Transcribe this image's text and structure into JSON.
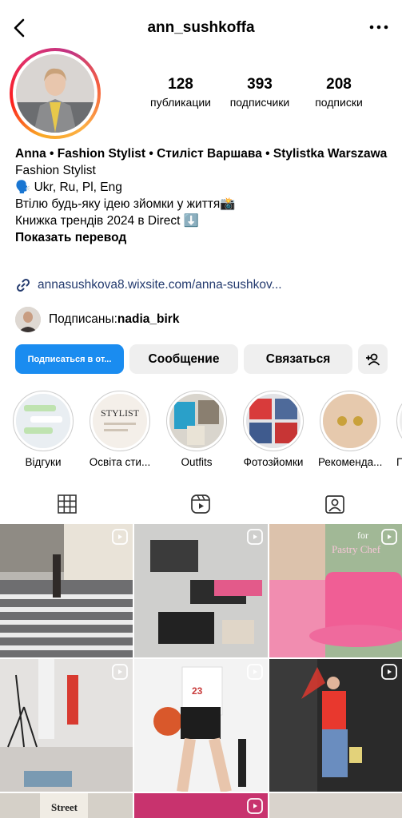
{
  "header": {
    "username": "ann_sushkoffa",
    "back_icon": "chevron-left-icon",
    "more_icon": "more-horizontal-icon"
  },
  "stats": [
    {
      "value": "128",
      "label": "публикации"
    },
    {
      "value": "393",
      "label": "подписчики"
    },
    {
      "value": "208",
      "label": "подписки"
    }
  ],
  "bio": {
    "name": "Anna • Fashion Stylist • Стиліст Варшава • Stylistka Warszawa",
    "category": "Fashion Stylist",
    "lines": [
      "🗣️ Ukr, Ru, Pl, Eng",
      "Втілю будь-яку ідею зйомки у життя📸",
      "Книжка трендів 2024 в Direct ⬇️"
    ],
    "translate": "Показать перевод"
  },
  "link": {
    "text": "annasushkova8.wixsite.com/anna-sushkov..."
  },
  "followed_by": {
    "prefix": "Подписаны: ",
    "name": "nadia_birk"
  },
  "buttons": {
    "follow": "Подписаться в от...",
    "message": "Сообщение",
    "contact": "Связаться",
    "add_user_icon": "add-user-icon"
  },
  "highlights": [
    {
      "label": "Відгуки"
    },
    {
      "label": "Освіта сти..."
    },
    {
      "label": "Outfits"
    },
    {
      "label": "Фотозйомки"
    },
    {
      "label": "Рекоменда..."
    },
    {
      "label": "Г"
    }
  ],
  "highlight_texts": {
    "stylist_cover": "STYLIST"
  },
  "tabs": [
    {
      "name": "grid",
      "icon": "grid-icon",
      "active": true
    },
    {
      "name": "reels",
      "icon": "reels-icon",
      "active": false
    },
    {
      "name": "tagged",
      "icon": "tagged-icon",
      "active": false
    }
  ],
  "posts": {
    "post3_text_a": "for",
    "post3_text_b": "Pastry Chef",
    "post7_text": "Street"
  },
  "colors": {
    "accent": "#1a8cf0",
    "link": "#233a6e",
    "button_bg": "#efefef"
  }
}
